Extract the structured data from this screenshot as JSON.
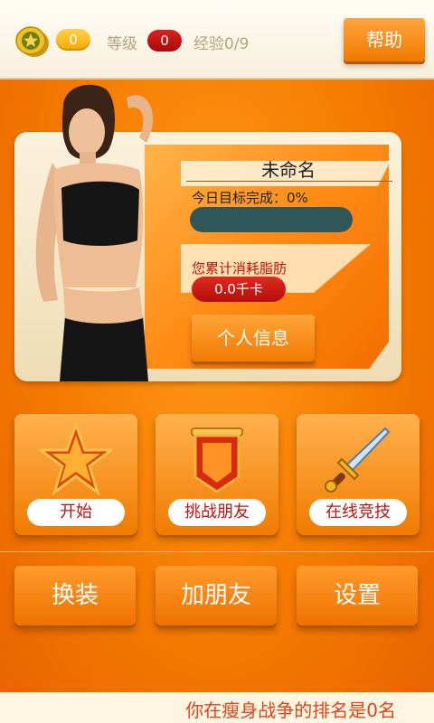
{
  "header": {
    "coins": "0",
    "level_label": "等级",
    "level": "0",
    "experience": "经验0/9",
    "help_label": "帮助"
  },
  "profile": {
    "name": "未命名",
    "goal_label": "今日目标完成：0%",
    "goal_progress": 0,
    "fat_label": "您累计消耗脂肪",
    "kcal": "0.0千卡",
    "info_button": "个人信息"
  },
  "modes": [
    {
      "label": "开始",
      "icon": "star-icon"
    },
    {
      "label": "挑战朋友",
      "icon": "banner-icon"
    },
    {
      "label": "在线竞技",
      "icon": "sword-icon"
    }
  ],
  "actions": [
    {
      "label": "换装"
    },
    {
      "label": "加朋友"
    },
    {
      "label": "设置"
    }
  ],
  "footer": {
    "ranking": "你在瘦身战争的排名是0名"
  }
}
